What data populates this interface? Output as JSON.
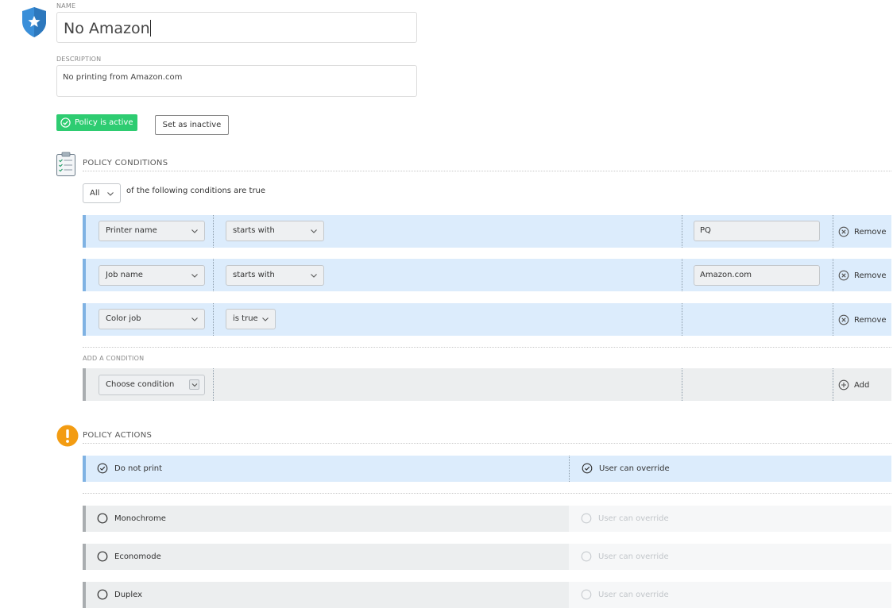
{
  "policy": {
    "name_label": "NAME",
    "name_value": "No Amazon",
    "description_label": "DESCRIPTION",
    "description_value": "No printing from Amazon.com",
    "status_badge": "Policy is active",
    "set_inactive_label": "Set as inactive"
  },
  "conditions": {
    "title": "POLICY CONDITIONS",
    "match_mode": "All",
    "match_text": "of the following conditions are true",
    "rows": [
      {
        "field": "Printer name",
        "operator": "starts with",
        "value": "PQ",
        "remove": "Remove"
      },
      {
        "field": "Job name",
        "operator": "starts with",
        "value": "Amazon.com",
        "remove": "Remove"
      },
      {
        "field": "Color job",
        "operator": "is true",
        "remove": "Remove"
      }
    ],
    "add_label": "ADD A CONDITION",
    "add_select": "Choose condition",
    "add_button": "Add"
  },
  "actions": {
    "title": "POLICY ACTIONS",
    "items": [
      {
        "label": "Do not print",
        "checked": true,
        "override": "User can override",
        "override_checked": true
      },
      {
        "label": "Monochrome",
        "checked": false,
        "override": "User can override"
      },
      {
        "label": "Economode",
        "checked": false,
        "override": "User can override"
      },
      {
        "label": "Duplex",
        "checked": false,
        "override": "User can override"
      }
    ]
  },
  "colors": {
    "accent_blue": "#3a8fd9",
    "active_green": "#2ecc71",
    "warning_orange": "#f39c12",
    "row_blue": "#dcecfc"
  }
}
